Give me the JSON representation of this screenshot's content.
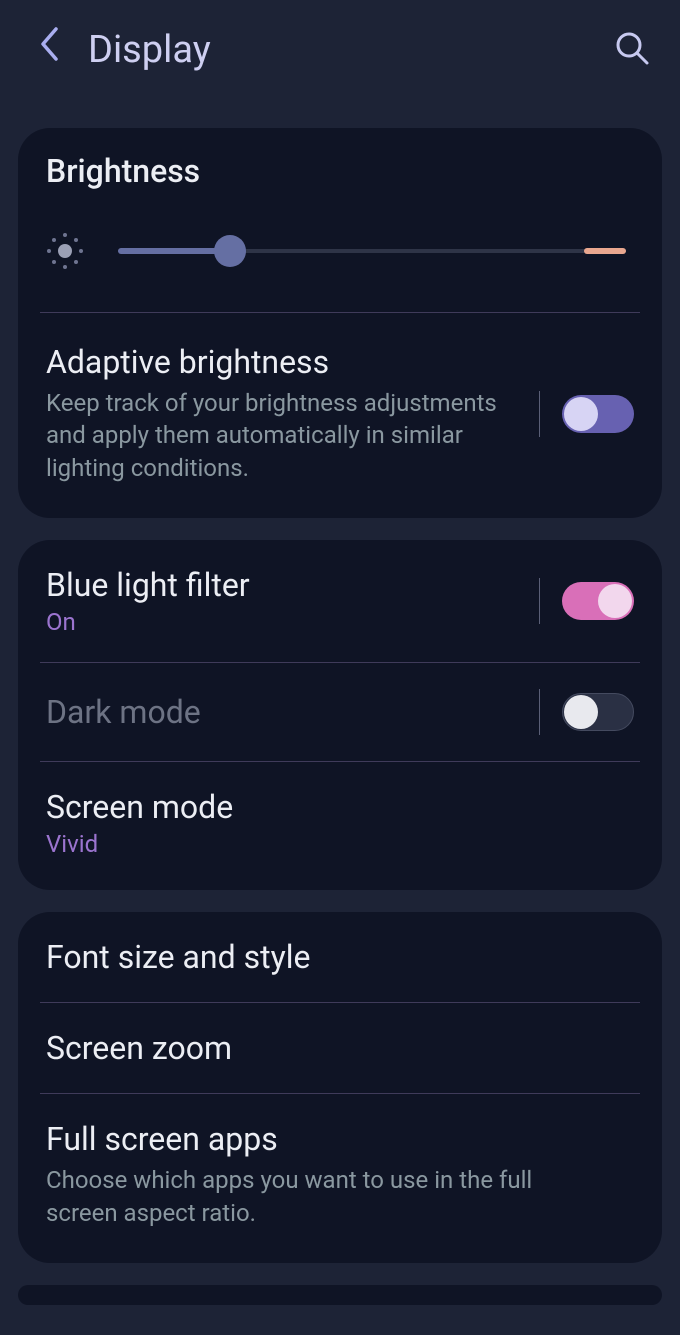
{
  "header": {
    "title": "Display"
  },
  "brightness": {
    "title": "Brightness",
    "value_pct": 22
  },
  "adaptive": {
    "title": "Adaptive brightness",
    "desc": "Keep track of your brightness adjustments and apply them automatically in similar lighting conditions.",
    "on": true
  },
  "bluelight": {
    "title": "Blue light filter",
    "status": "On",
    "on": true
  },
  "darkmode": {
    "title": "Dark mode",
    "on": false
  },
  "screenmode": {
    "title": "Screen mode",
    "status": "Vivid"
  },
  "fontsize": {
    "title": "Font size and style"
  },
  "screenzoom": {
    "title": "Screen zoom"
  },
  "fullscreen": {
    "title": "Full screen apps",
    "desc": "Choose which apps you want to use in the full screen aspect ratio."
  }
}
